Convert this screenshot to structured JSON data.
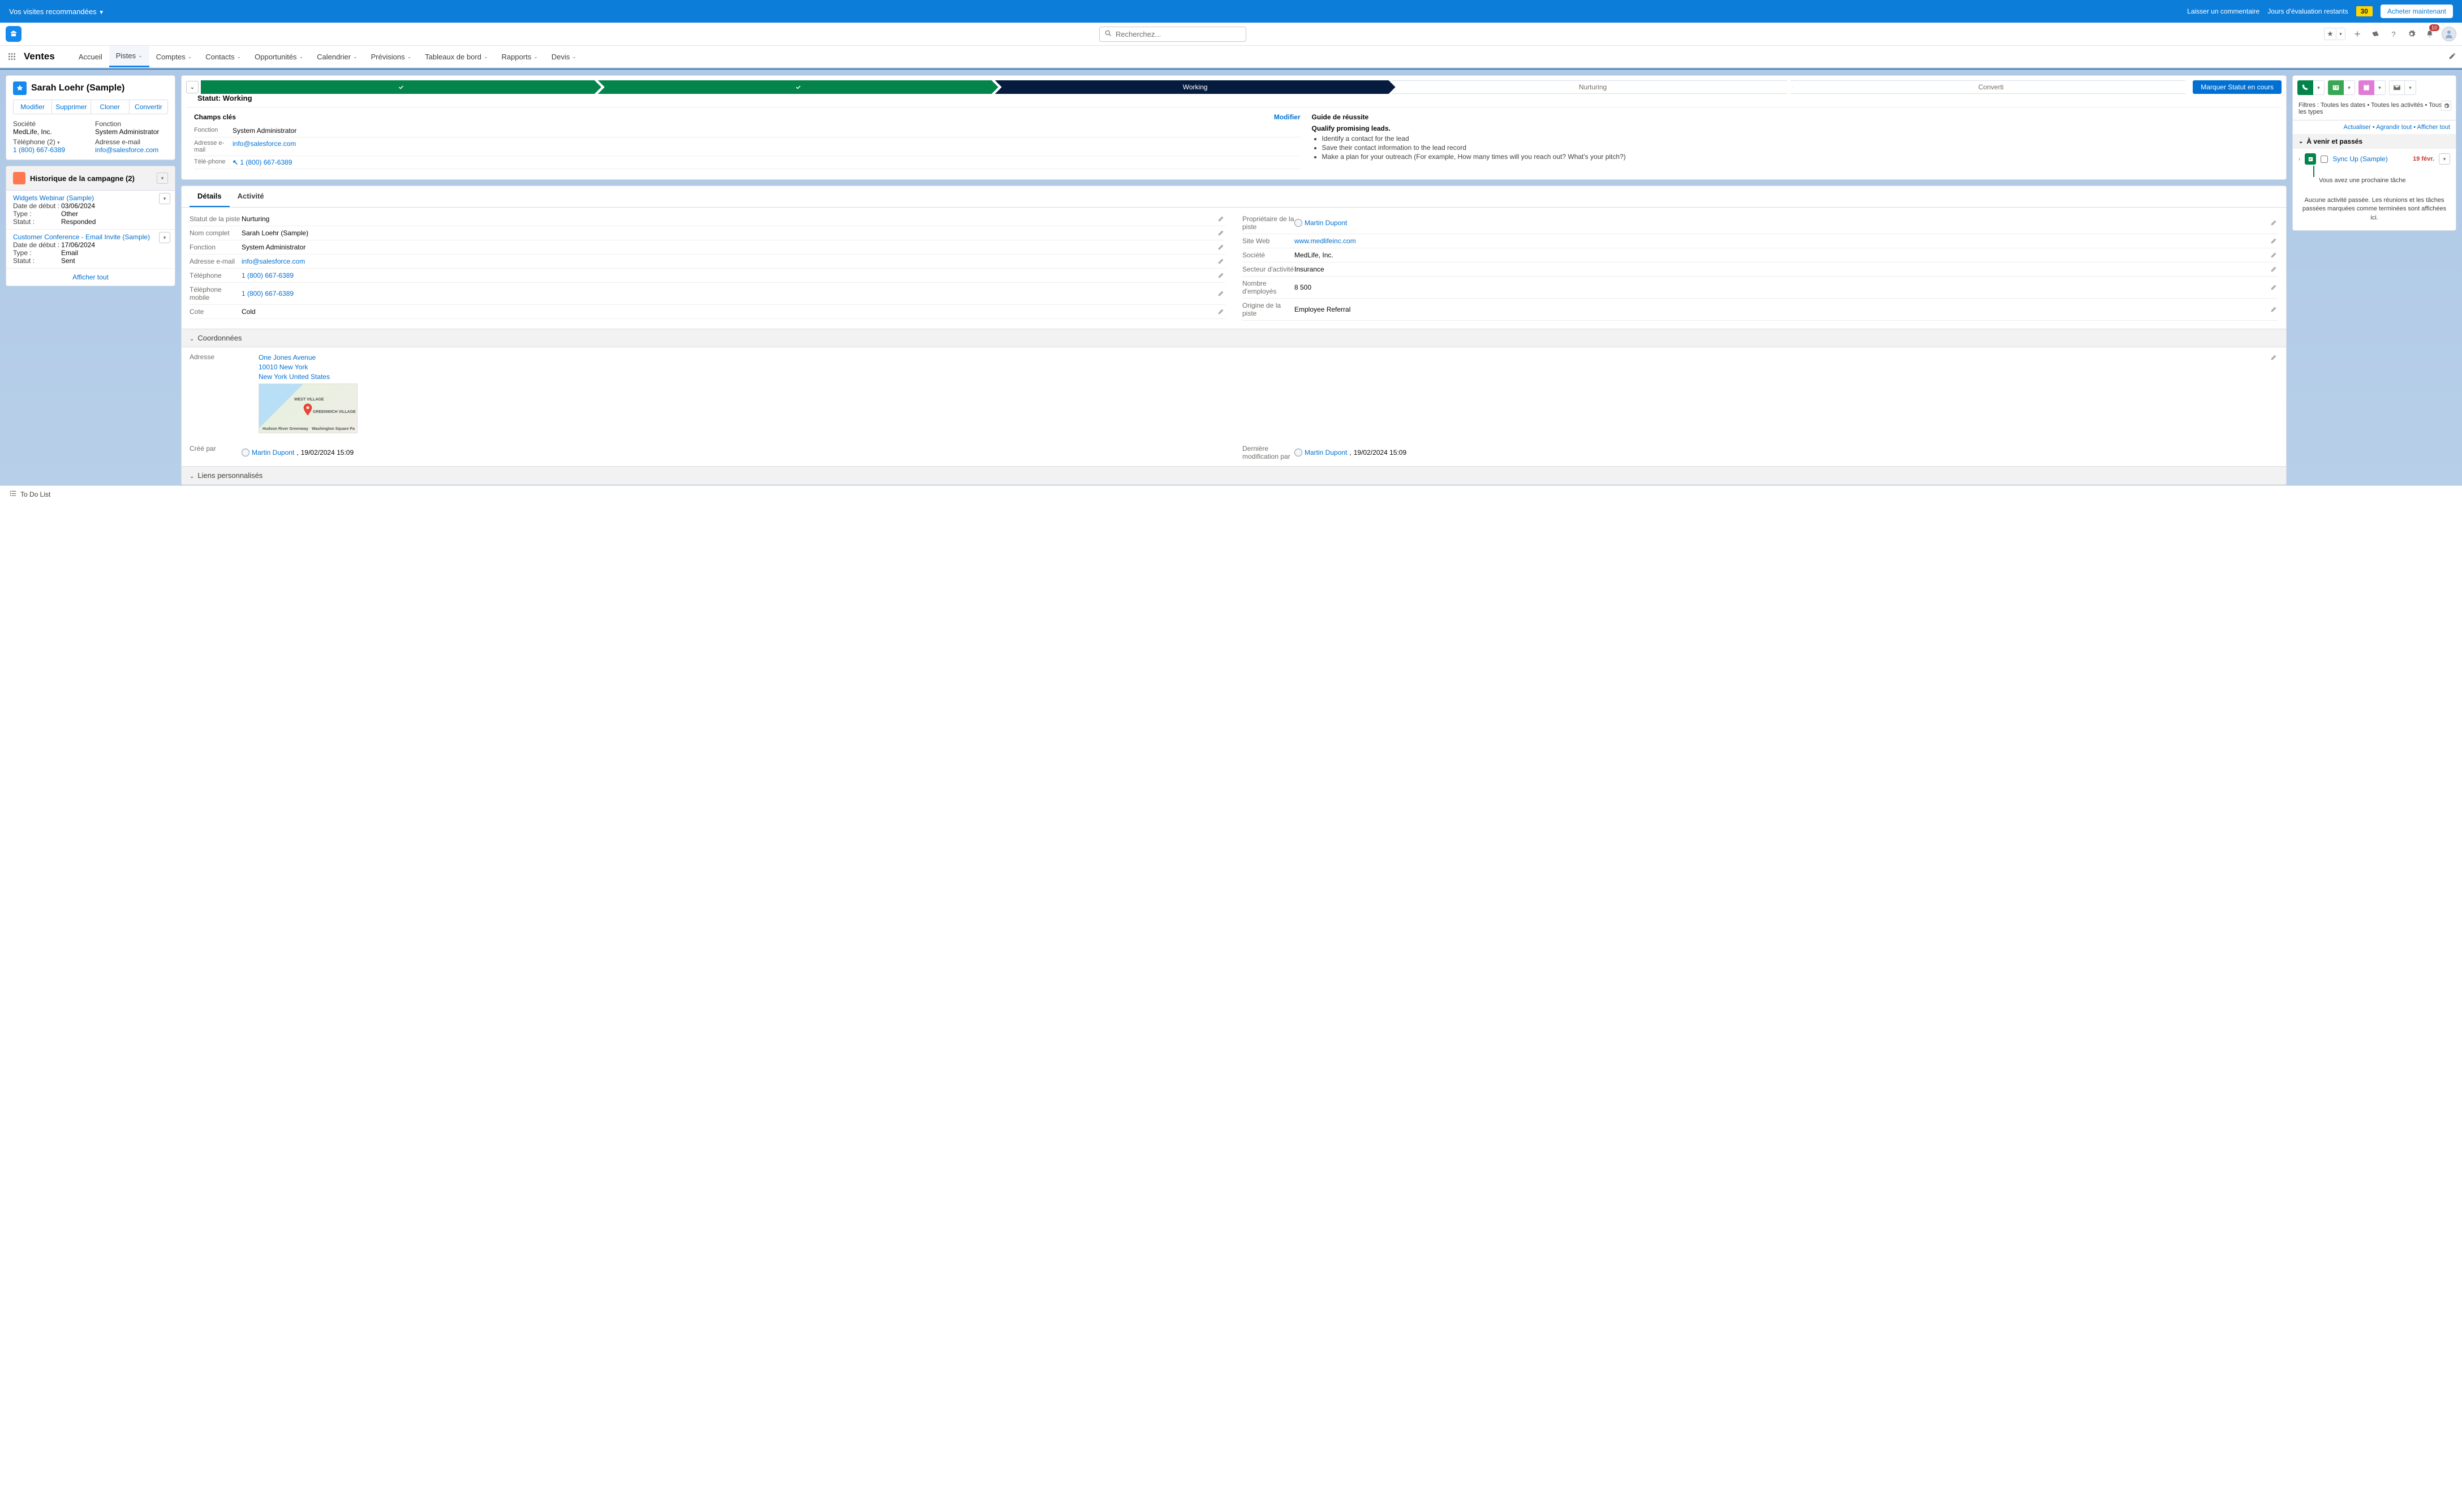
{
  "banner": {
    "left": "Vos visites recommandées",
    "comment": "Laisser un commentaire",
    "trial": "Jours d'évaluation restants",
    "days": "30",
    "buy": "Acheter maintenant"
  },
  "search_placeholder": "Recherchez...",
  "notif_count": "10",
  "app_name": "Ventes",
  "nav": [
    "Accueil",
    "Pistes",
    "Comptes",
    "Contacts",
    "Opportunités",
    "Calendrier",
    "Prévisions",
    "Tableaux de bord",
    "Rapports",
    "Devis"
  ],
  "nav_active": "Pistes",
  "highlight": {
    "name": "Sarah Loehr (Sample)",
    "actions": [
      "Modifier",
      "Supprimer",
      "Cloner",
      "Convertir"
    ],
    "f1l": "Société",
    "f1v": "MedLife, Inc.",
    "f2l": "Fonction",
    "f2v": "System Administrator",
    "f3l": "Téléphone (2)",
    "f3v": "1 (800) 667-6389",
    "f4l": "Adresse e-mail",
    "f4v": "info@salesforce.com"
  },
  "campaign": {
    "title": "Historique de la campagne (2)",
    "items": [
      {
        "name": "Widgets Webinar (Sample)",
        "rows": [
          [
            "Date de début :",
            "03/06/2024"
          ],
          [
            "Type :",
            "Other"
          ],
          [
            "Statut :",
            "Responded"
          ]
        ]
      },
      {
        "name": "Customer Conference - Email Invite (Sample)",
        "rows": [
          [
            "Date de début :",
            "17/06/2024"
          ],
          [
            "Type :",
            "Email"
          ],
          [
            "Statut :",
            "Sent"
          ]
        ]
      }
    ],
    "view_all": "Afficher tout"
  },
  "path": {
    "steps": [
      "",
      "",
      "Working",
      "Nurturing",
      "Converti"
    ],
    "mark": "Marquer Statut en cours",
    "status_label": "Statut: Working",
    "key_fields": "Champs clés",
    "modifier": "Modifier",
    "fields": [
      [
        "Fonction",
        "System Administrator",
        false
      ],
      [
        "Adresse e-mail",
        "info@salesforce.com",
        true
      ],
      [
        "Télé-phone",
        "1 (800) 667-6389",
        true
      ]
    ],
    "guide_label": "Guide de réussite",
    "guide_head": "Qualify promising leads.",
    "guide_items": [
      "Identify a contact for the lead",
      "Save their contact information to the lead record",
      "Make a plan for your outreach (For example, How many times will you reach out? What's your pitch?)"
    ]
  },
  "tabs": {
    "detail": "Détails",
    "activity": "Activité"
  },
  "details": {
    "left": [
      [
        "Statut de la piste",
        "Nurturing",
        false
      ],
      [
        "Nom complet",
        "Sarah Loehr (Sample)",
        false
      ],
      [
        "Fonction",
        "System Administrator",
        false
      ],
      [
        "Adresse e-mail",
        "info@salesforce.com",
        true
      ],
      [
        "Téléphone",
        "1 (800) 667-6389",
        true
      ],
      [
        "Téléphone mobile",
        "1 (800) 667-6389",
        true
      ],
      [
        "Cote",
        "Cold",
        false
      ]
    ],
    "right": [
      [
        "Propriétaire de la piste",
        "Martin Dupont",
        "owner"
      ],
      [
        "Site Web",
        "www.medlifeinc.com",
        true
      ],
      [
        "Société",
        "MedLife, Inc.",
        false
      ],
      [
        "Secteur d'activité",
        "Insurance",
        false
      ],
      [
        "Nombre d'employés",
        "8 500",
        false
      ],
      [
        "Origine de la piste",
        "Employee Referral",
        false
      ]
    ]
  },
  "coord": {
    "label": "Coordonnées",
    "addr_label": "Adresse",
    "addr": [
      "One Jones Avenue",
      "10010 New York",
      "New York United States"
    ],
    "map": {
      "labels": [
        "WEST VILLAGE",
        "GREENWICH VILLAGE",
        "Hudson River Greenway",
        "Washington Square Pa"
      ]
    }
  },
  "created": {
    "by_label": "Créé par",
    "by": "Martin Dupont",
    "by_date": "19/02/2024 15:09",
    "mod_label": "Dernière modification par",
    "mod": "Martin Dupont",
    "mod_date": "19/02/2024 15:09"
  },
  "custom_links": "Liens personnalisés",
  "right": {
    "filters": "Filtres : Toutes les dates • Toutes les activités • Tous les types",
    "links": [
      "Actualiser",
      "Agrandir tout",
      "Afficher tout"
    ],
    "upcoming": "À venir et passés",
    "task": {
      "name": "Sync Up (Sample)",
      "date": "19 févr.",
      "sub": "Vous avez une prochaine tâche"
    },
    "empty": "Aucune activité passée. Les réunions et les tâches passées marquées comme terminées sont affichées ici."
  },
  "footer": "To Do List"
}
